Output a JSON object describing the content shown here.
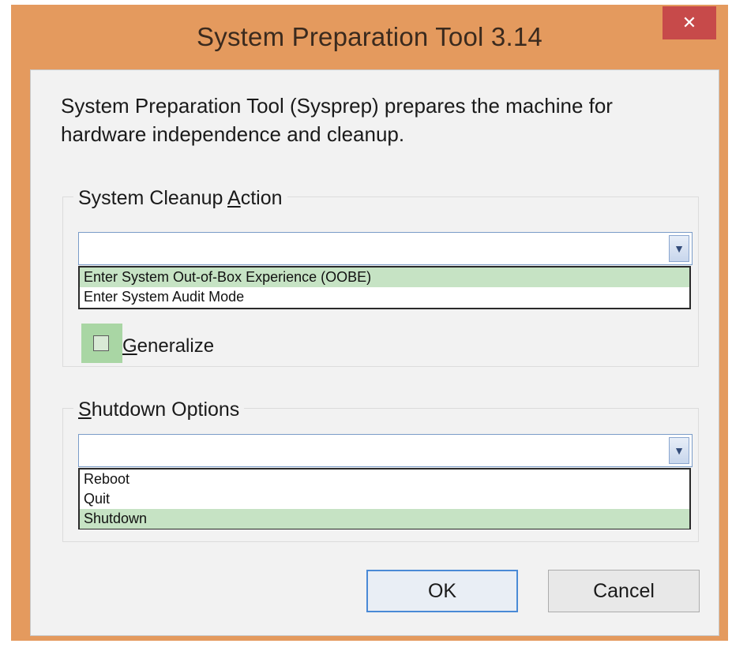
{
  "window": {
    "title": "System Preparation Tool 3.14",
    "close_glyph": "✕"
  },
  "description": "System Preparation Tool (Sysprep) prepares the machine for hardware independence and cleanup.",
  "cleanup": {
    "label_before": "System Cleanup ",
    "label_access_key": "A",
    "label_after": "ction",
    "selected_value": "",
    "options": [
      {
        "label": "Enter System Out-of-Box Experience (OOBE)",
        "selected": true
      },
      {
        "label": "Enter System Audit Mode",
        "selected": false
      }
    ]
  },
  "generalize": {
    "label_access_key": "G",
    "label_after": "eneralize",
    "checked": false
  },
  "shutdown": {
    "label_access_key": "S",
    "label_after": "hutdown Options",
    "selected_value": "",
    "options": [
      {
        "label": "Reboot",
        "selected": false
      },
      {
        "label": "Quit",
        "selected": false
      },
      {
        "label": "Shutdown",
        "selected": true
      }
    ]
  },
  "buttons": {
    "ok": "OK",
    "cancel": "Cancel"
  },
  "icons": {
    "dropdown_arrow": "chevron-down-icon",
    "close": "close-icon"
  },
  "colors": {
    "frame": "#e49a5e",
    "close_button": "#c74a4a",
    "selection": "#c6e3c4",
    "checkbox_focus": "#a9d6a4",
    "default_button_border": "#4a8ad6"
  }
}
